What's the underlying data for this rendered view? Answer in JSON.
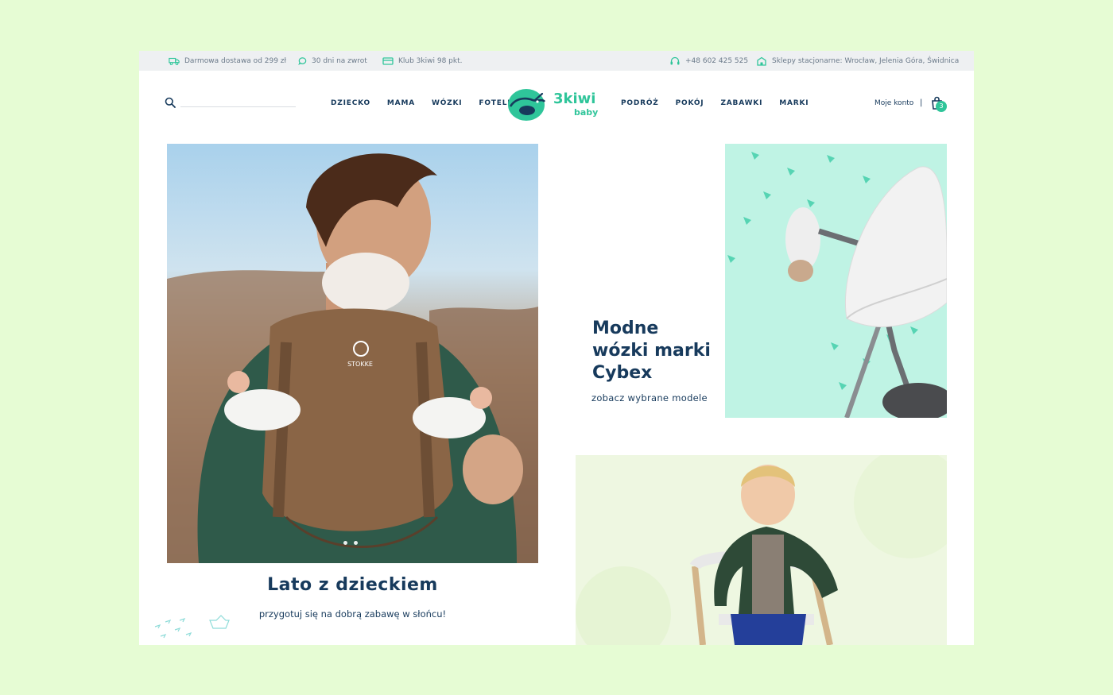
{
  "topbar": {
    "delivery": "Darmowa dostawa od 299 zł",
    "returns": "30 dni na zwrot",
    "club": "Klub 3kiwi 98 pkt.",
    "phone": "+48 602 425 525",
    "stores": "Sklepy stacjonarne: Wrocław, Jelenia Góra, Świdnica"
  },
  "search": {
    "placeholder": ""
  },
  "nav_left": [
    "DZIECKO",
    "MAMA",
    "WÓZKI",
    "FOTELIKI"
  ],
  "nav_right": [
    "PODRÓŻ",
    "POKÓJ",
    "ZABAWKI",
    "MARKI"
  ],
  "logo": {
    "name": "3kiwi",
    "sub": "baby",
    "brand_color": "#2fc59a"
  },
  "header": {
    "account": "Moje konto",
    "separator": "|",
    "cart_count": "3"
  },
  "hero": {
    "carrier_brand": "STOKKE",
    "title": "Lato z dzieckiem",
    "subtitle": "przygotuj się na dobrą zabawę w słońcu!",
    "slides": 2
  },
  "cybex": {
    "title_line1": "Modne",
    "title_line2": "wózki marki",
    "title_line3": "Cybex",
    "link": "zobacz wybrane modele"
  },
  "colors": {
    "navy": "#173a5c",
    "mint": "#bff3e4",
    "accent": "#2fc59a"
  },
  "icons": [
    "truck-icon",
    "chat-icon",
    "card-icon",
    "headset-icon",
    "store-icon",
    "search-icon",
    "cart-icon"
  ]
}
